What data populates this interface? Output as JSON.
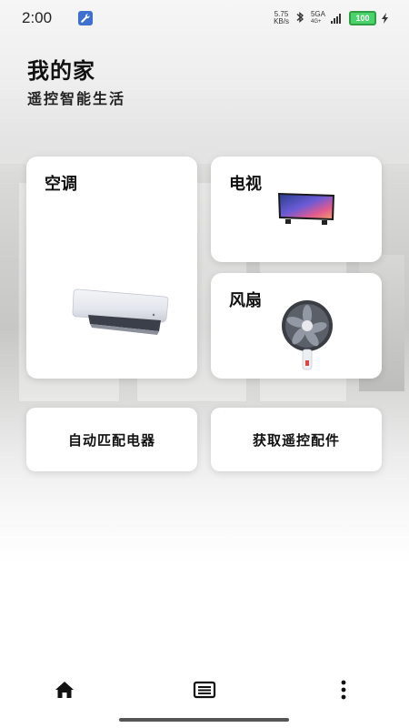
{
  "status_bar": {
    "time": "2:00",
    "net_speed_value": "5.75",
    "net_speed_unit": "KB/s",
    "network": "5GA",
    "network_sub": "4G+",
    "battery": "100"
  },
  "header": {
    "title": "我的家",
    "subtitle": "遥控智能生活"
  },
  "devices": {
    "ac": {
      "label": "空调",
      "icon": "air-conditioner-icon"
    },
    "tv": {
      "label": "电视",
      "icon": "tv-icon"
    },
    "fan": {
      "label": "风扇",
      "icon": "fan-icon"
    }
  },
  "actions": {
    "auto_match": "自动匹配电器",
    "get_accessories": "获取遥控配件"
  },
  "bottom_nav": {
    "home_icon": "home-icon",
    "list_icon": "list-icon",
    "more_icon": "more-vertical-icon"
  },
  "colors": {
    "battery": "#4ad36a",
    "wrench_badge": "#3f6fcf",
    "card_bg": "#ffffff"
  }
}
